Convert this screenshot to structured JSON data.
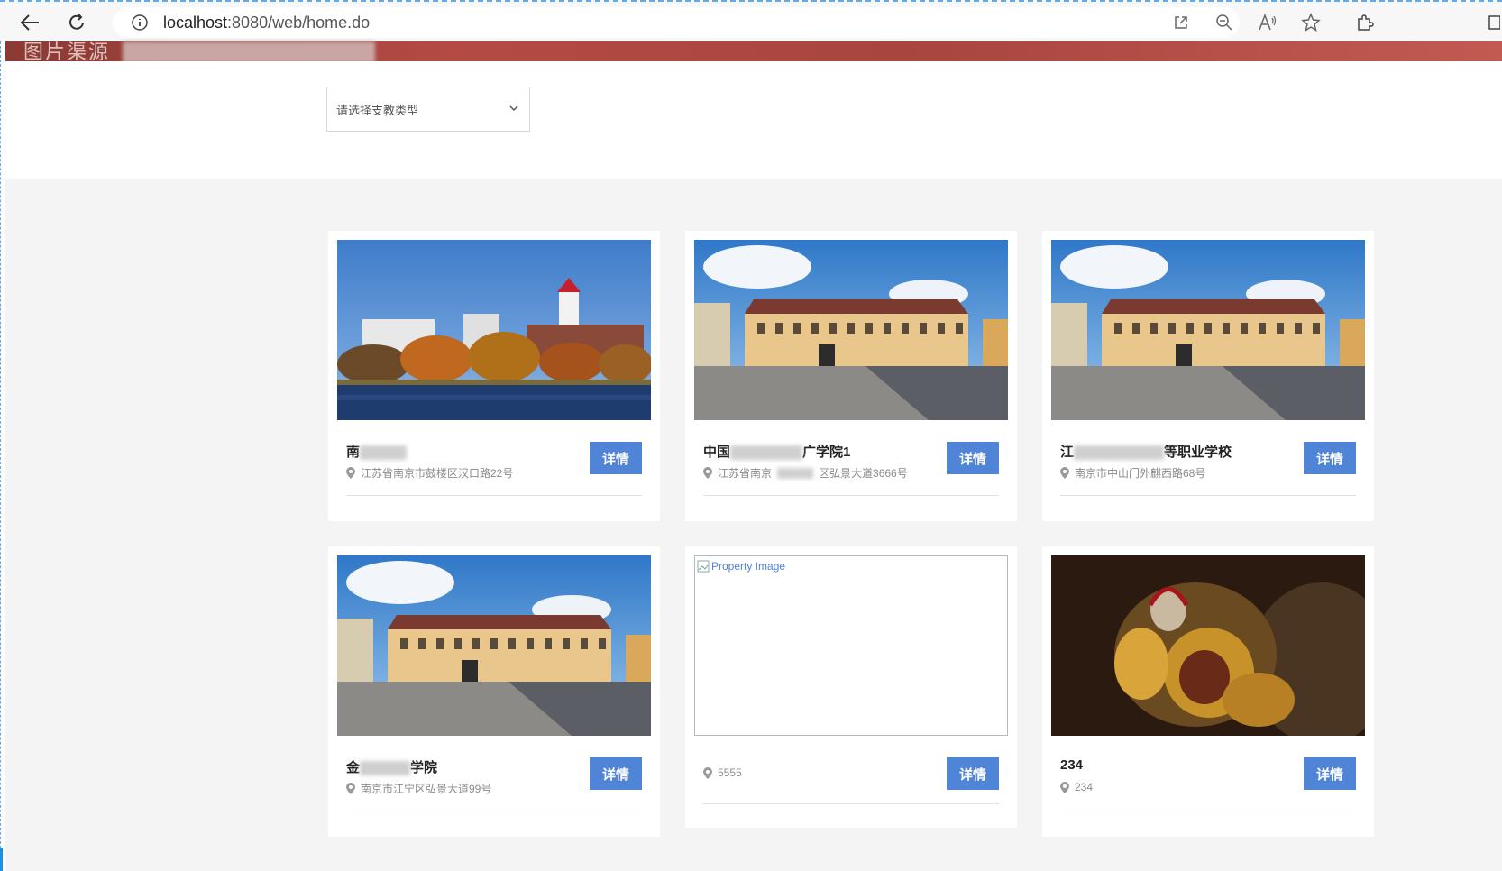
{
  "browser": {
    "url_host": "localhost",
    "url_path": ":8080/web/home.do",
    "icons": [
      "back-icon",
      "reload-icon",
      "info-icon",
      "open-external-icon",
      "zoom-out-icon",
      "read-aloud-icon",
      "favorite-star-icon",
      "extensions-icon"
    ]
  },
  "banner": {
    "title": "图片渠源"
  },
  "filter": {
    "placeholder": "请选择支教类型"
  },
  "buttons": {
    "detail": "详情"
  },
  "cards": [
    {
      "title_visible": "南",
      "address": "江苏省南京市鼓楼区汉口路22号",
      "image": "campus-autumn-clocktower"
    },
    {
      "title_visible": "中国",
      "title_suffix": "广学院1",
      "address": "江苏省南京",
      "address_suffix": "区弘景大道3666号",
      "image": "palace-square"
    },
    {
      "title_visible": "江",
      "title_suffix": "等职业学校",
      "address": "南京市中山门外麒西路68号",
      "image": "palace-square"
    },
    {
      "title_visible": "金",
      "title_suffix": "学院",
      "address": "南京市江宁区弘景大道99号",
      "image": "palace-square"
    },
    {
      "title_visible": "",
      "address": "5555",
      "image": "broken",
      "alt": "Property Image"
    },
    {
      "title_visible": "234",
      "address": "234",
      "image": "warrior-game-art"
    }
  ],
  "colors": {
    "accent": "#4f84d6",
    "banner": "#a8453f",
    "page_bg": "#f4f4f4"
  }
}
